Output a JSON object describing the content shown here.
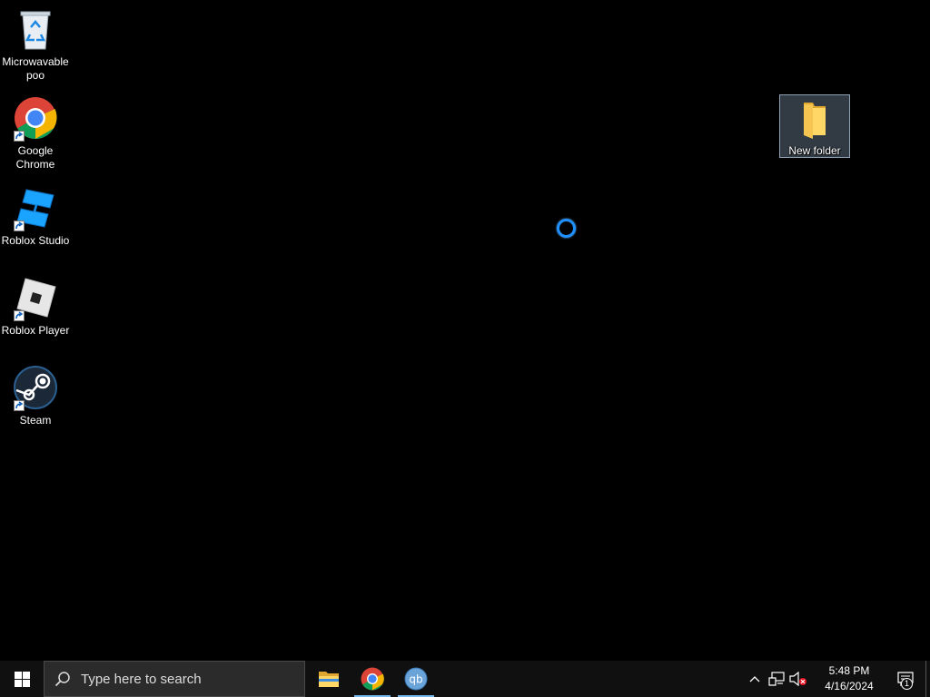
{
  "desktop": {
    "icons": [
      {
        "label": "Microwavable\npoo",
        "icon": "recycle-bin-icon"
      },
      {
        "label": "Google\nChrome",
        "icon": "chrome-icon"
      },
      {
        "label": "Roblox Studio",
        "icon": "roblox-studio-icon"
      },
      {
        "label": "Roblox Player",
        "icon": "roblox-player-icon"
      },
      {
        "label": "Steam",
        "icon": "steam-icon"
      },
      {
        "label": "New folder",
        "icon": "folder-icon"
      }
    ],
    "cursor": "busy-spinner-icon"
  },
  "taskbar": {
    "search": {
      "placeholder": "Type here to search"
    },
    "pinned": [
      {
        "name": "File Explorer",
        "icon": "file-explorer-icon"
      },
      {
        "name": "Google Chrome",
        "icon": "chrome-icon",
        "active": true
      },
      {
        "name": "qBittorrent",
        "icon": "qbittorrent-icon",
        "active": true
      }
    ],
    "clock": {
      "time": "5:48 PM",
      "date": "4/16/2024"
    },
    "notifications": {
      "count": "1"
    }
  },
  "colors": {
    "accent": "#76b9ed",
    "desktop_bg": "#000000",
    "taskbar_bg": "#101010",
    "spinner": "#1e90ff"
  }
}
